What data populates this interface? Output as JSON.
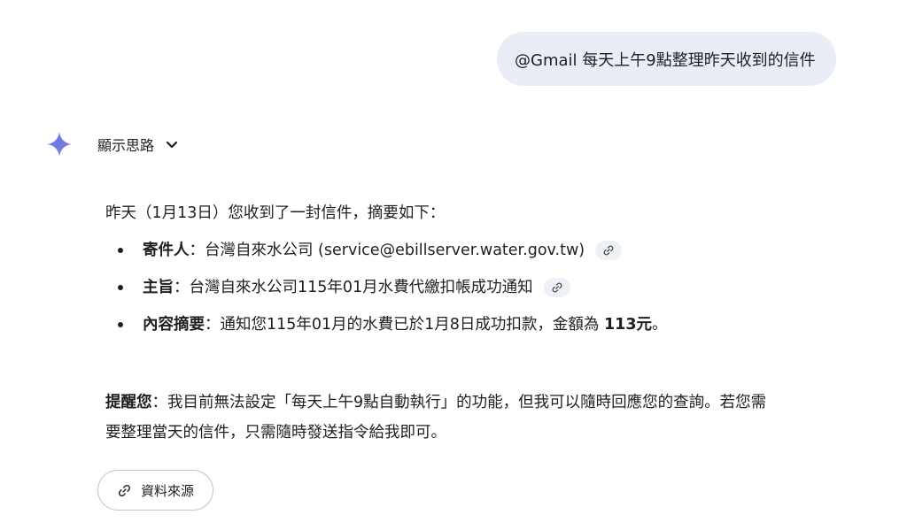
{
  "user_prompt": "@Gmail 每天上午9點整理昨天收到的信件",
  "thinking": {
    "label": "顯示思路",
    "icon": "chevron-down-icon"
  },
  "response": {
    "intro": "昨天（1月13日）您收到了一封信件，摘要如下：",
    "items": [
      {
        "label": "寄件人",
        "separator": "：",
        "text": "台灣自來水公司 (service@ebillserver.water.gov.tw)",
        "has_citation": true
      },
      {
        "label": "主旨",
        "separator": "：",
        "text": "台灣自來水公司115年01月水費代繳扣帳成功通知",
        "has_citation": true
      },
      {
        "label": "內容摘要",
        "separator": "：",
        "text_before": "通知您115年01月的水費已於1月8日成功扣款，金額為 ",
        "amount": "113元",
        "text_after": "。"
      }
    ],
    "note": {
      "label": "提醒您",
      "separator": "：",
      "line1": "我目前無法設定「每天上午9點自動執行」的功能，但我可以隨時回應您的查詢。若您需",
      "line2": "要整理當天的信件，只需隨時發送指令給我即可。"
    }
  },
  "sources_button": {
    "label": "資料來源",
    "icon": "link-icon"
  },
  "colors": {
    "user_bubble": "#e9eef6",
    "spark_start": "#4285f4",
    "spark_end": "#9b72cb",
    "chip_bg": "#eef1f5",
    "border": "#c4c7c5"
  }
}
